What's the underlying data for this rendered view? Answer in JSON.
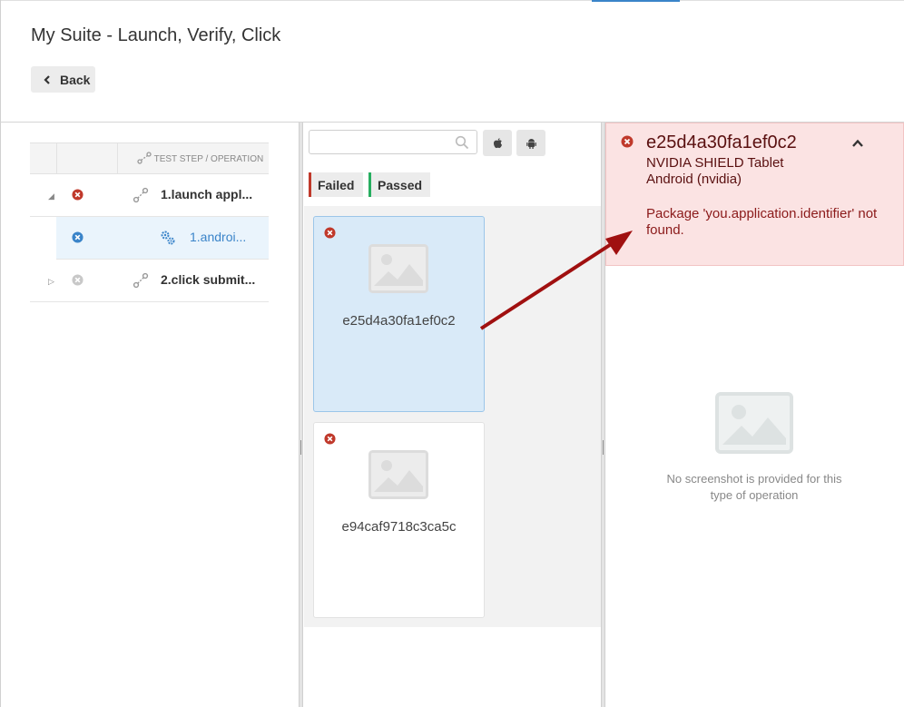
{
  "page": {
    "title": "My Suite - Launch, Verify, Click",
    "back_label": "Back"
  },
  "tree": {
    "header_label": "TEST STEP / OPERATION",
    "rows": [
      {
        "label": "1.launch appl...",
        "status": "failed",
        "expander": "expanded"
      },
      {
        "label": "1.androi...",
        "status": "failed-info"
      },
      {
        "label": "2.click submit...",
        "status": "skipped",
        "expander": "collapsed"
      }
    ]
  },
  "devices_panel": {
    "search": {
      "placeholder": "",
      "value": ""
    },
    "os_filters": [
      "apple-icon",
      "android-icon"
    ],
    "filters": [
      {
        "label": "Failed",
        "color": "#c0392b"
      },
      {
        "label": "Passed",
        "color": "#27ae60"
      }
    ],
    "cards": [
      {
        "id": "e25d4a30fa1ef0c2",
        "status": "failed",
        "selected": true
      },
      {
        "id": "e94caf9718c3ca5c",
        "status": "failed",
        "selected": false
      }
    ]
  },
  "detail": {
    "device_id": "e25d4a30fa1ef0c2",
    "device_name": "NVIDIA SHIELD Tablet",
    "device_os": "Android (nvidia)",
    "message": "Package 'you.application.identifier' not found.",
    "empty_message": "No screenshot is provided for this type of operation"
  },
  "colors": {
    "failed": "#c0392b",
    "info": "#3a84c9",
    "alert_bg": "#fbe3e3",
    "selected_card": "#d9eaf8",
    "arrow": "#a01010"
  }
}
